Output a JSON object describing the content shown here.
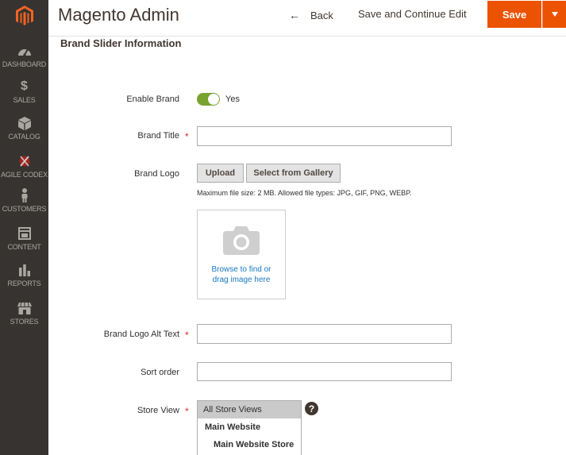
{
  "header": {
    "title": "Magento Admin",
    "back_label": "Back",
    "save_continue_label": "Save and Continue Edit",
    "save_label": "Save"
  },
  "sidebar": {
    "items": [
      {
        "label": "DASHBOARD",
        "icon": "dashboard-icon"
      },
      {
        "label": "SALES",
        "icon": "dollar-icon"
      },
      {
        "label": "CATALOG",
        "icon": "cube-icon"
      },
      {
        "label": "AGILE CODEX",
        "icon": "agile-codex-icon"
      },
      {
        "label": "CUSTOMERS",
        "icon": "person-icon"
      },
      {
        "label": "CONTENT",
        "icon": "layout-icon"
      },
      {
        "label": "REPORTS",
        "icon": "bar-chart-icon"
      },
      {
        "label": "STORES",
        "icon": "storefront-icon"
      }
    ]
  },
  "form": {
    "section_title": "Brand Slider Information",
    "enable_brand": {
      "label": "Enable Brand",
      "value": "Yes",
      "checked": true
    },
    "brand_title": {
      "label": "Brand Title",
      "value": ""
    },
    "brand_logo": {
      "label": "Brand Logo",
      "upload_label": "Upload",
      "gallery_label": "Select from Gallery",
      "hint": "Maximum file size: 2 MB. Allowed file types: JPG, GIF, PNG, WEBP.",
      "dropzone_line1": "Browse to find or",
      "dropzone_line2": "drag image here"
    },
    "brand_logo_alt": {
      "label": "Brand Logo Alt Text",
      "value": ""
    },
    "sort_order": {
      "label": "Sort order",
      "value": ""
    },
    "store_view": {
      "label": "Store View",
      "options": [
        "All Store Views",
        "Main Website",
        "Main Website Store"
      ],
      "selected": "All Store Views",
      "help": "?"
    }
  },
  "colors": {
    "sidebar_bg": "#373330",
    "accent": "#eb5202",
    "toggle_on": "#79a22e",
    "link": "#1979c3",
    "required": "#e22626"
  }
}
